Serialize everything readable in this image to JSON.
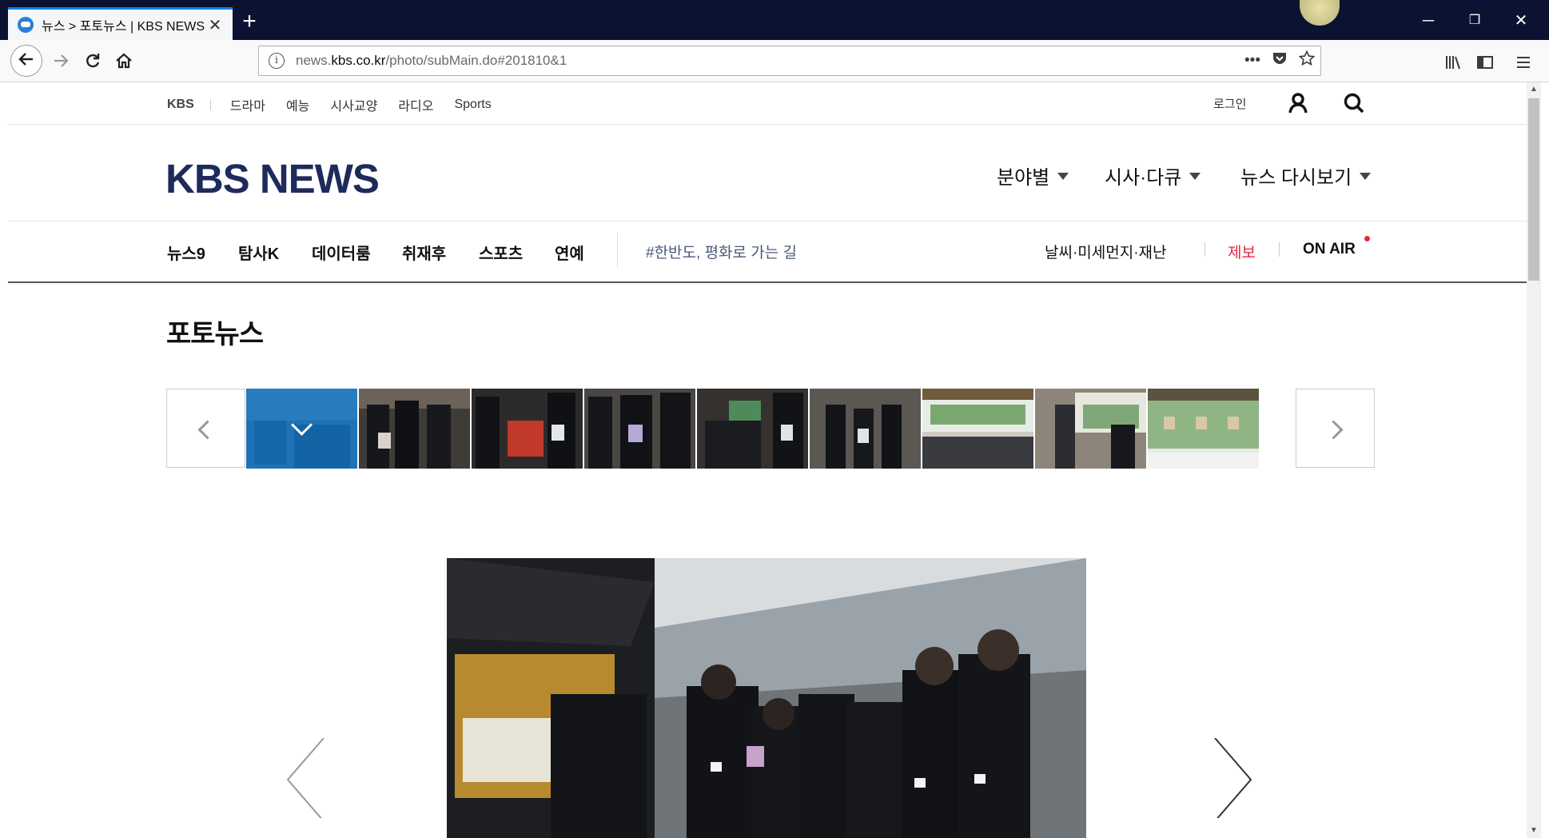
{
  "browser": {
    "tab_title": "뉴스 > 포토뉴스 | KBS NEWS",
    "tab_close": "✕",
    "new_tab": "+",
    "url_prefix": "news.",
    "url_domain": "kbs.co.kr",
    "url_path": "/photo/subMain.do#201810&1",
    "window_controls": [
      "─",
      "❐",
      "✕"
    ],
    "url_icons": [
      "•••",
      "pocket-icon",
      "star-icon"
    ],
    "toolbar_icons": [
      "library-icon",
      "sidebar-icon",
      "menu-icon"
    ]
  },
  "utility_bar": {
    "brand": "KBS",
    "links": [
      "드라마",
      "예능",
      "시사교양",
      "라디오",
      "Sports"
    ],
    "login": "로그인"
  },
  "header": {
    "logo": "KBS NEWS",
    "menus": [
      "분야별",
      "시사·다큐",
      "뉴스 다시보기"
    ]
  },
  "gnb": {
    "items": [
      "뉴스9",
      "탐사K",
      "데이터룸",
      "취재후",
      "스포츠",
      "연예"
    ],
    "hashtag": "#한반도, 평화로 가는 길",
    "weather": "날씨·미세먼지·재난",
    "report": "제보",
    "onair": "ON AIR"
  },
  "section": {
    "title": "포토뉴스"
  },
  "colors": {
    "titlebar": "#0c1231",
    "accent": "#0a84ff",
    "logo": "#1f2a5c",
    "report_red": "#e5263e",
    "thumb_selected": "#1274c2"
  },
  "thumbnail_count": 9,
  "selected_thumbnail": 1
}
